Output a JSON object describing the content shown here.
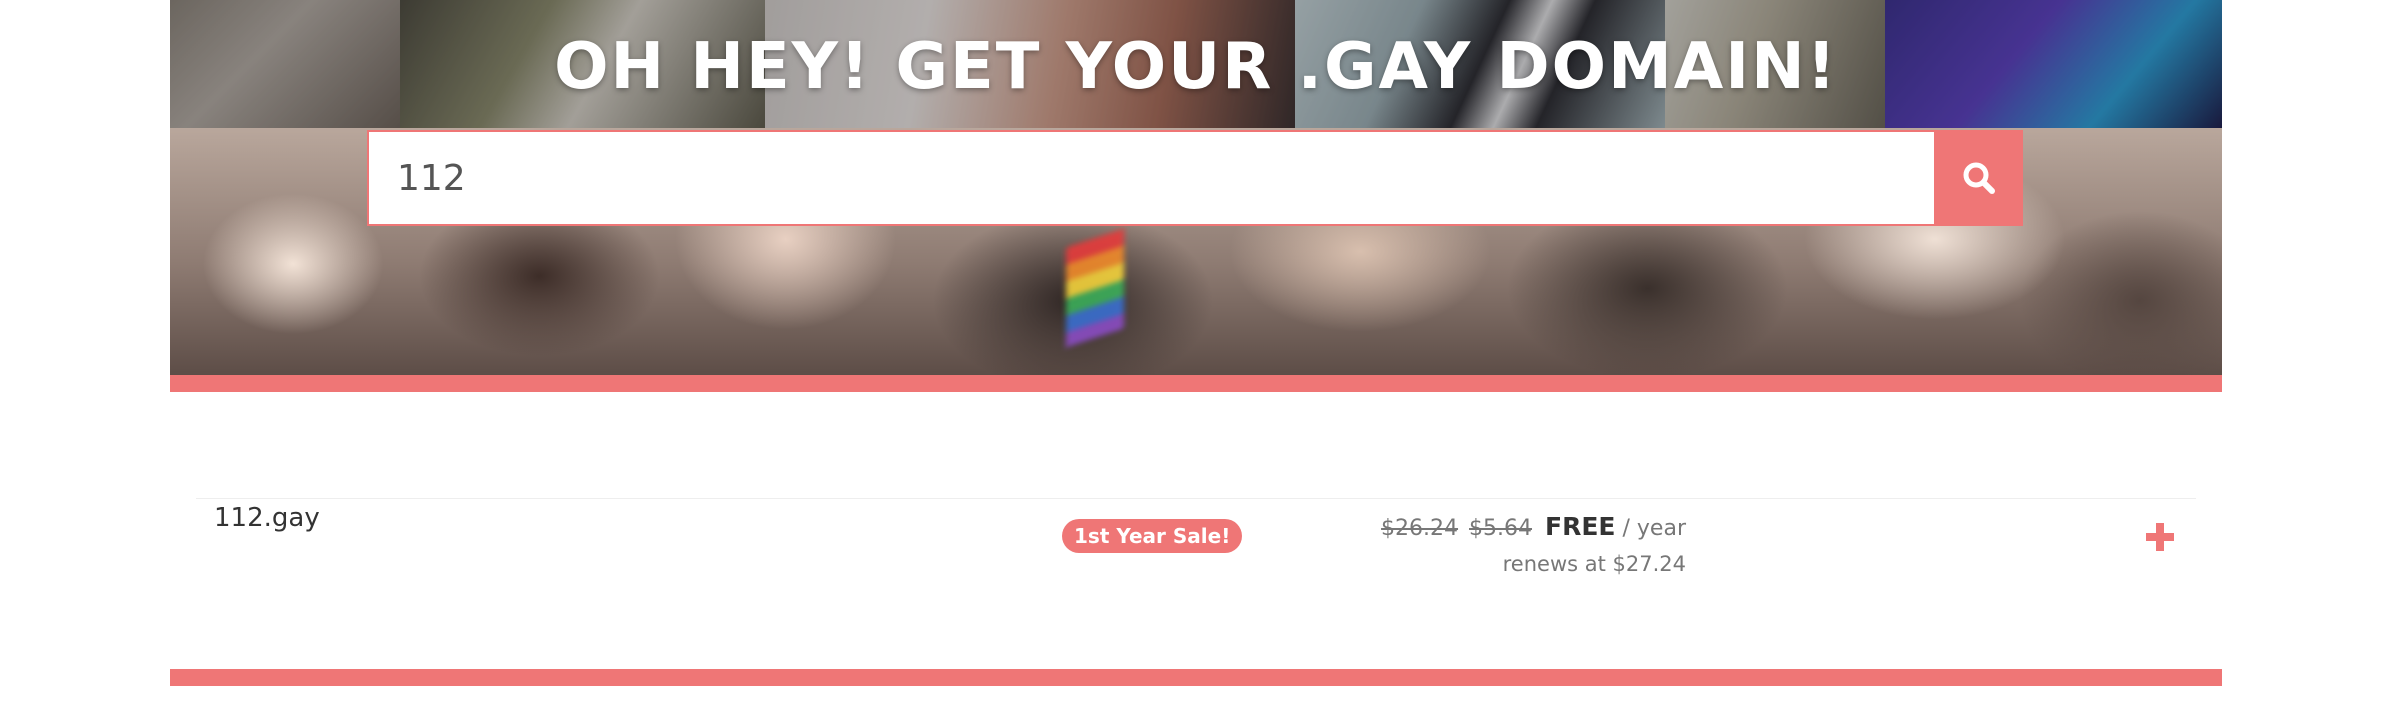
{
  "hero": {
    "title": "OH HEY! GET YOUR .GAY DOMAIN!"
  },
  "search": {
    "value": "112",
    "button_icon": "search-icon"
  },
  "results": [
    {
      "domain": "112.gay",
      "badge": "1st Year Sale!",
      "original_price": "$26.24",
      "sale_price": "$5.64",
      "current_price": "FREE",
      "period": "/ year",
      "renewal": "renews at $27.24",
      "action_icon": "plus-icon"
    }
  ],
  "colors": {
    "accent": "#ef7676",
    "text_dark": "#333333",
    "text_muted": "#777777"
  }
}
